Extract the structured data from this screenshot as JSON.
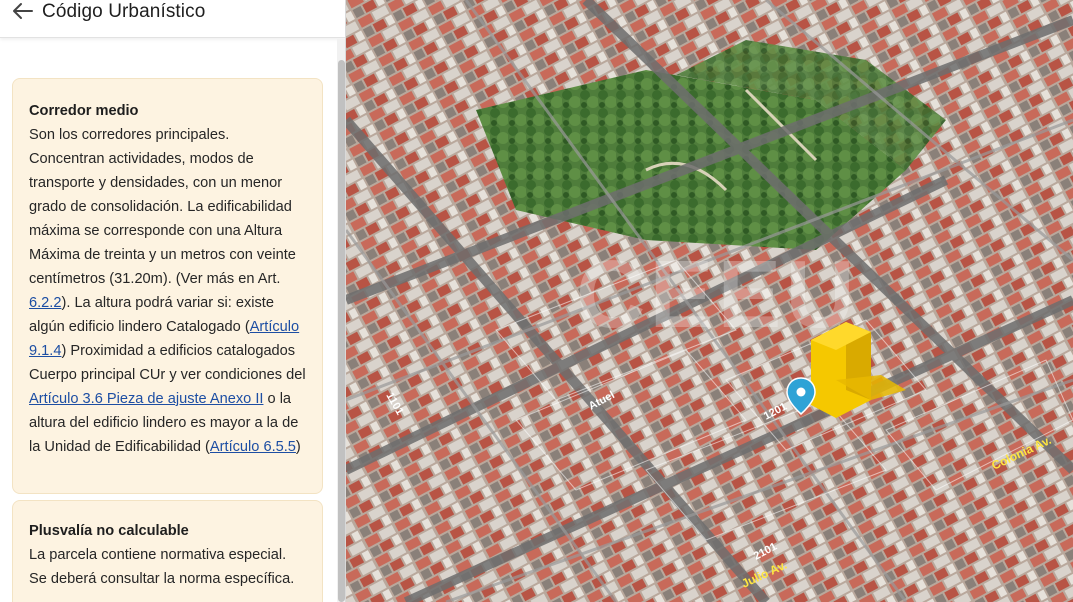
{
  "header": {
    "title": "Código Urbanístico",
    "back_icon": "arrow-left-icon"
  },
  "cards": {
    "corredor": {
      "title": "Corredor medio",
      "text_1": "Son los corredores principales. Concentran actividades, modos de transporte y densidades, con un menor grado de consolidación. La edificabilidad máxima se corresponde con una Altura Máxima de treinta y un metros con veinte centímetros (31.20m). (Ver más en Art. ",
      "link_1": "6.2.2",
      "text_2": "). La altura podrá variar si: existe algún edificio lindero Catalogado (",
      "link_2": "Artículo 9.1.4",
      "text_3": ") Proximidad a edificios catalogados Cuerpo principal CUr y ver condiciones del ",
      "link_3": "Artículo 3.6 Pieza de ajuste Anexo II",
      "text_4": " o la altura del edificio lindero es mayor a la de la Unidad de Edificabilidad (",
      "link_4": "Artículo 6.5.5",
      "text_5": ")"
    },
    "plusvalia": {
      "title": "Plusvalía no calculable",
      "text": "La parcela contiene normativa especial. Se deberá consultar la norma específica."
    }
  },
  "map": {
    "watermark": "CEEU",
    "streets": [
      "Colonia Av.",
      "Julio Av.",
      "1101",
      "1201",
      "2101",
      "Atuel"
    ],
    "marker_icon": "location-pin-icon",
    "marker_color": "#2ea3d6",
    "building_color": "#f5c800"
  },
  "colors": {
    "card_bg": "#fdf3e1",
    "link": "#1d4ea3"
  }
}
